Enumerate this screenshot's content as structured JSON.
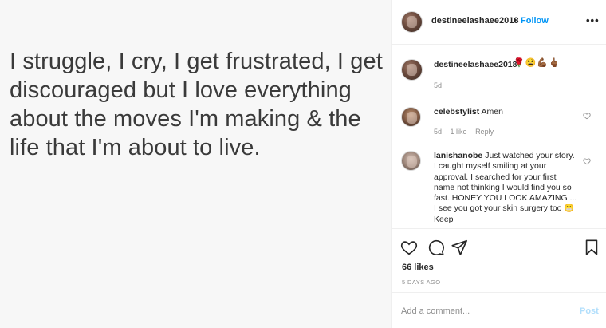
{
  "post": {
    "quote": "I struggle, I cry, I get frustrated, I get discouraged but I love everything about  the moves I'm making & the life that I'm about to live."
  },
  "header": {
    "username": "destineelashaee2018",
    "separator": "•",
    "follow_label": "Follow",
    "more_label": "•••"
  },
  "caption": {
    "username": "destineelashaee2018",
    "emojis": "🌹😩💪🏾🖕🏾",
    "time": "5d"
  },
  "comments": [
    {
      "username": "celebstylist",
      "text": "Amen",
      "time": "5d",
      "likes": "1 like",
      "reply_label": "Reply"
    },
    {
      "username": "lanishanobe",
      "text": "Just watched your story. I caught myself smiling at your approval. I searched for your first name not thinking I would find you so fast. HONEY YOU LOOK AMAZING ... I see you got your skin surgery too 😬 Keep"
    }
  ],
  "actions": {
    "likes_count": "66 likes",
    "date": "5 DAYS AGO"
  },
  "add_comment": {
    "placeholder": "Add a comment...",
    "post_label": "Post"
  },
  "colors": {
    "follow_blue": "#0095f6",
    "post_disabled": "#b2dffc",
    "muted": "#8e8e8e",
    "text": "#262626"
  },
  "icons": [
    "more-icon",
    "heart-icon",
    "comment-icon",
    "share-icon",
    "bookmark-icon"
  ]
}
